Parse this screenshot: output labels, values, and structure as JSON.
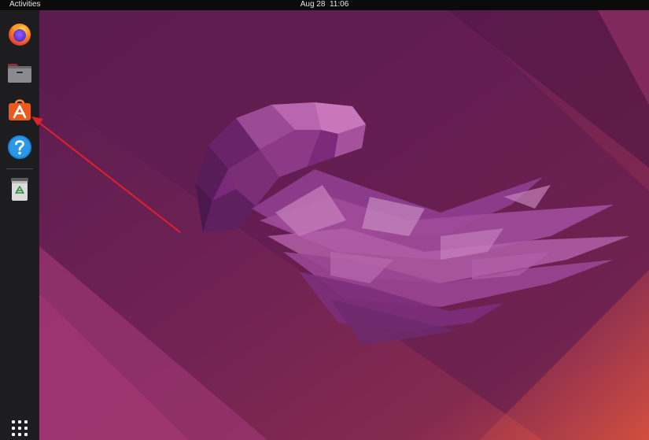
{
  "topbar": {
    "activities_label": "Activities",
    "clock": "Aug 28  11:06"
  },
  "dock": {
    "items": [
      {
        "name": "firefox",
        "icon": "firefox-icon"
      },
      {
        "name": "files",
        "icon": "files-icon"
      },
      {
        "name": "ubuntu-software",
        "icon": "ubuntu-software-icon"
      },
      {
        "name": "help",
        "icon": "help-icon"
      },
      {
        "name": "trash",
        "icon": "trash-icon"
      }
    ],
    "show_apps_icon": "show-apps-grid-icon"
  },
  "annotation": {
    "arrow_color": "#e0202a",
    "points_to": "ubuntu-software"
  },
  "colors": {
    "topbar": "#0b0b0b",
    "dock": "#1d1d1f",
    "wallpaper_base": "#6e1f52",
    "wallpaper_accent": "#c04050"
  }
}
